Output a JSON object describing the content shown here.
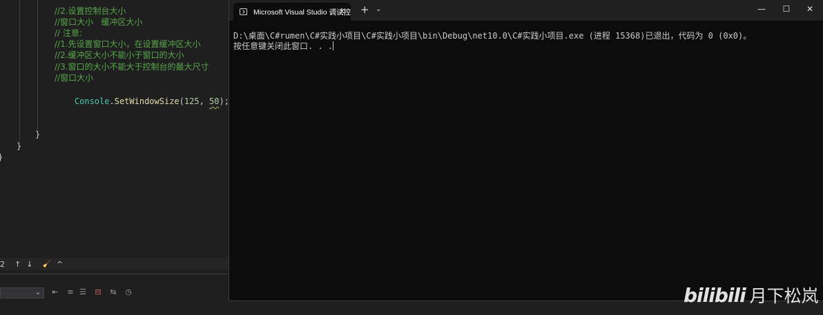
{
  "editor": {
    "lines": [
      {
        "type": "comment",
        "text": "//2.设置控制台大小"
      },
      {
        "type": "comment",
        "text": "//窗口大小   缓冲区大小"
      },
      {
        "type": "comment",
        "text": "// 注意:"
      },
      {
        "type": "comment",
        "text": "//1.先设置窗口大小，在设置缓冲区大小"
      },
      {
        "type": "comment",
        "text": "//2.缓冲区大小不能小于窗口的大小"
      },
      {
        "type": "comment",
        "text": "//3.窗口的大小不能大于控制台的最大尺寸"
      },
      {
        "type": "comment",
        "text": "//窗口大小"
      }
    ],
    "code": {
      "class": "Console",
      "dot": ".",
      "method": "SetWindowSize",
      "open": "(",
      "arg1": "125",
      "sep": ", ",
      "arg2": "50",
      "close": ");"
    },
    "brace1": "}",
    "brace2": "}",
    "brace3": "}"
  },
  "findbar": {
    "count": "2",
    "up": "↑",
    "down": "↓",
    "clear": "🧹",
    "collapse": "^"
  },
  "bottom_panel": {
    "select_arrow": "⌄"
  },
  "terminal": {
    "tab_title": "Microsoft Visual Studio 调试控",
    "tab_close": "✕",
    "new_tab": "+",
    "dropdown": "⌄",
    "minimize": "—",
    "maximize": "☐",
    "close": "✕",
    "output_line1": "D:\\桌面\\C#rumen\\C#实践小项目\\C#实践小项目\\bin\\Debug\\net10.0\\C#实践小项目.exe (进程 15368)已退出，代码为 0 (0x0)。",
    "output_line2": "按任意键关闭此窗口. . ."
  },
  "watermark": {
    "logo": "bilibili",
    "name": "月下松岚"
  },
  "colors": {
    "comment": "#57a64a",
    "class": "#4ec9b0",
    "method": "#dcdcaa",
    "number": "#b5cea8",
    "console_bg": "#0c0c0c"
  }
}
